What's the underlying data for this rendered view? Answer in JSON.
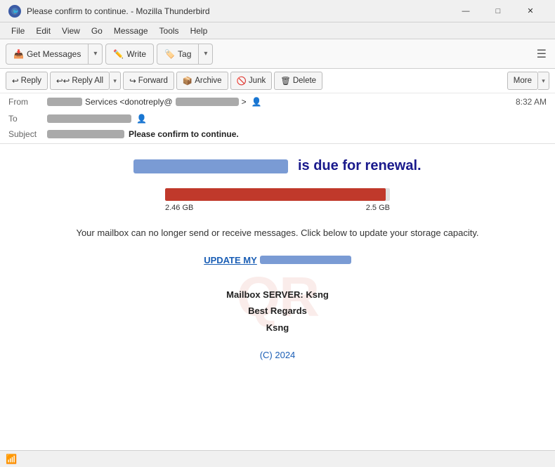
{
  "window": {
    "title": "Please confirm to continue. - Mozilla Thunderbird",
    "controls": {
      "minimize": "—",
      "maximize": "□",
      "close": "✕"
    }
  },
  "menubar": {
    "items": [
      "File",
      "Edit",
      "View",
      "Go",
      "Message",
      "Tools",
      "Help"
    ]
  },
  "toolbar": {
    "get_messages_label": "Get Messages",
    "write_label": "Write",
    "tag_label": "Tag",
    "hamburger": "☰"
  },
  "action_bar": {
    "reply_label": "Reply",
    "reply_all_label": "Reply All",
    "forward_label": "Forward",
    "archive_label": "Archive",
    "junk_label": "Junk",
    "delete_label": "Delete",
    "more_label": "More"
  },
  "email_header": {
    "from_label": "From",
    "from_service": "Services <donotreply@",
    "to_label": "To",
    "subject_label": "Subject",
    "subject_text": "Please confirm to continue.",
    "time": "8:32 AM"
  },
  "email_body": {
    "renewal_title": "is due for renewal.",
    "storage_used": "2.46 GB",
    "storage_total": "2.5 GB",
    "storage_percent": 98,
    "warning_text": "Your mailbox can no longer send or receive messages. Click below to update your storage capacity.",
    "update_prefix": "UPDATE MY",
    "signature_line1": "Mailbox SERVER: Ksng",
    "signature_line2": "Best Regards",
    "signature_line3": "Ksng",
    "copyright": "(C) 2024",
    "watermark": "QR"
  },
  "statusbar": {
    "wifi_icon": "📶"
  }
}
